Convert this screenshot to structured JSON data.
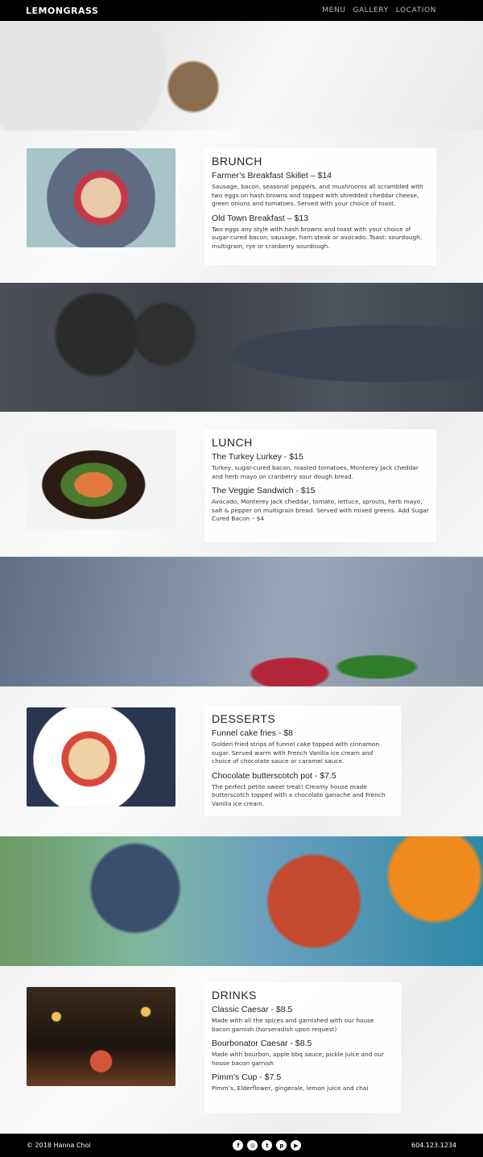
{
  "nav": {
    "brand": "LEMONGRASS",
    "links": [
      "MENU",
      "GALLERY",
      "LOCATION"
    ]
  },
  "sections": [
    {
      "title": "BRUNCH",
      "items": [
        {
          "name": "Farmer’s Breakfast Skillet – $14",
          "desc": "Sausage, bacon, seasonal peppers, and mushrooms all scrambled with two eggs on hash browns and topped with shredded cheddar cheese, green onions and tomatoes. Served with your choice of toast."
        },
        {
          "name": "Old Town Breakfast – $13",
          "desc": "Two eggs any style with hash browns and toast with your choice of sugar-cured bacon, sausage, ham steak or avocado. Toast: sourdough, multigrain, rye or cranberry sourdough."
        }
      ]
    },
    {
      "title": "LUNCH",
      "items": [
        {
          "name": "The Turkey Lurkey - $15",
          "desc": "Turkey, sugar-cured bacon, roasted tomatoes, Monterey Jack cheddar and herb mayo on cranberry sour dough bread."
        },
        {
          "name": "The Veggie Sandwich - $15",
          "desc": "Avocado, Monterey Jack cheddar, tomato, lettuce, sprouts, herb mayo, salt & pepper on multigrain bread. Served with mixed greens. Add Sugar Cured Bacon – $4"
        }
      ]
    },
    {
      "title": "DESSERTS",
      "items": [
        {
          "name": "Funnel cake fries - $8",
          "desc": "Golden fried strips of funnel cake topped with cinnamon sugar. Served warm with French Vanilla ice cream and choice of chocolate sauce or caramel sauce."
        },
        {
          "name": "Chocolate butterscotch pot - $7.5",
          "desc": "The perfect petite sweet treat! Creamy house made butterscotch topped with a chocolate ganache and French Vanilla ice cream."
        }
      ]
    },
    {
      "title": "DRINKS",
      "items": [
        {
          "name": "Classic Caesar - $8.5",
          "desc": "Made with all the spices and garnished with our house bacon garnish (horseradish upon request)"
        },
        {
          "name": "Bourbonator Caesar - $8.5",
          "desc": "Made with bourbon, apple bbq sauce, pickle juice and our house bacon garnish"
        },
        {
          "name": "Pimm’s Cup - $7.5",
          "desc": "Pimm’s, Elderflower, gingerale, lemon juice and chai"
        }
      ]
    }
  ],
  "footer": {
    "copyright": "© 2018 Hanna Choi",
    "phone": "604.123.1234",
    "socials": [
      {
        "icon": "facebook-icon",
        "glyph": "f"
      },
      {
        "icon": "instagram-icon",
        "glyph": "◎"
      },
      {
        "icon": "twitter-icon",
        "glyph": "t"
      },
      {
        "icon": "pinterest-icon",
        "glyph": "p"
      },
      {
        "icon": "youtube-icon",
        "glyph": "▶"
      }
    ]
  }
}
